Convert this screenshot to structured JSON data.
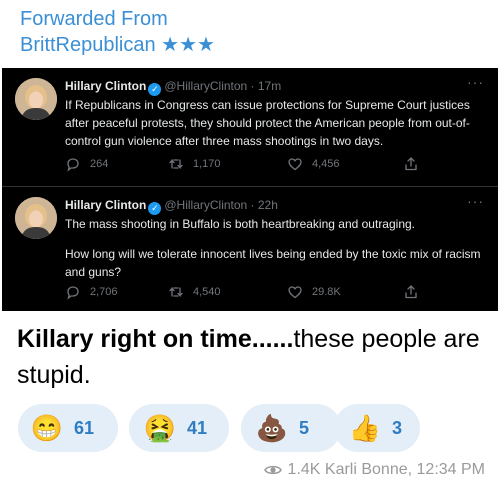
{
  "forwarded": {
    "label": "Forwarded From",
    "source_name": "BrittRepublican ★★★"
  },
  "tweets": [
    {
      "name": "Hillary Clinton",
      "handle": "@HillaryClinton · 17m",
      "more": "···",
      "paragraphs": [
        "If Republicans in Congress can issue protections for Supreme Court justices after peaceful protests, they should protect the American people from out-of-control gun violence after three mass shootings in two days."
      ],
      "replies": "264",
      "retweets": "1,170",
      "likes": "4,456"
    },
    {
      "name": "Hillary Clinton",
      "handle": "@HillaryClinton · 22h",
      "more": "···",
      "paragraphs": [
        "The mass shooting in Buffalo is both heartbreaking and outraging.",
        "How long will we tolerate innocent lives being ended by the toxic mix of racism and guns?"
      ],
      "replies": "2,706",
      "retweets": "4,540",
      "likes": "29.8K"
    }
  ],
  "caption": {
    "bold": "Killary right on time......",
    "normal": "these people are stupid."
  },
  "reactions": [
    {
      "emoji": "😁",
      "icon": "grinning-face-icon",
      "count": "61"
    },
    {
      "emoji": "🤮",
      "icon": "vomiting-face-icon",
      "count": "41"
    },
    {
      "emoji": "💩",
      "icon": "pile-of-poo-icon",
      "count": "5"
    },
    {
      "emoji": "👍",
      "icon": "thumbs-up-icon",
      "count": "3"
    }
  ],
  "footer": {
    "meta": "1.4K Karli Bonne, 12:34 PM"
  },
  "colors": {
    "accent": "#3a8fd6",
    "tweet_bg": "#000000",
    "reaction_bg": "#e3eef8",
    "twitter_blue": "#1d9bf0"
  }
}
